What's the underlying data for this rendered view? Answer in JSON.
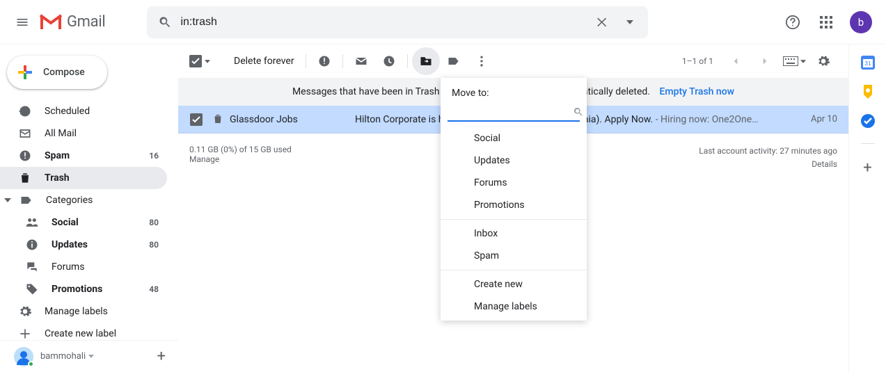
{
  "header": {
    "app_name": "Gmail",
    "search_value": "in:trash",
    "avatar_letter": "b"
  },
  "compose_label": "Compose",
  "sidebar": {
    "items": [
      {
        "label": "Scheduled"
      },
      {
        "label": "All Mail"
      },
      {
        "label": "Spam",
        "count": "16"
      },
      {
        "label": "Trash"
      },
      {
        "label": "Categories"
      },
      {
        "label": "Social",
        "count": "80"
      },
      {
        "label": "Updates",
        "count": "80"
      },
      {
        "label": "Forums"
      },
      {
        "label": "Promotions",
        "count": "48"
      },
      {
        "label": "Manage labels"
      },
      {
        "label": "Create new label"
      }
    ],
    "footer_user": "bammohali"
  },
  "toolbar": {
    "delete_forever": "Delete forever",
    "page_count": "1–1 of 1"
  },
  "banner": {
    "text": "Messages that have been in Trash more than 30 days will be automatically deleted.",
    "link": "Empty Trash now"
  },
  "row": {
    "sender": "Glassdoor Jobs",
    "subject": "Hilton Corporate is hiring now (San Francisco, California). Apply Now.",
    "snippet": " - Hiring now: One2One…",
    "date": "Apr 10"
  },
  "popover": {
    "title": "Move to:",
    "items_categories": [
      "Social",
      "Updates",
      "Forums",
      "Promotions"
    ],
    "items_system": [
      "Inbox",
      "Spam"
    ],
    "items_actions": [
      "Create new",
      "Manage labels"
    ]
  },
  "footer": {
    "storage": "0.11 GB (0%) of 15 GB used",
    "manage": "Manage",
    "activity": "Last account activity: 27 minutes ago",
    "details": "Details"
  }
}
